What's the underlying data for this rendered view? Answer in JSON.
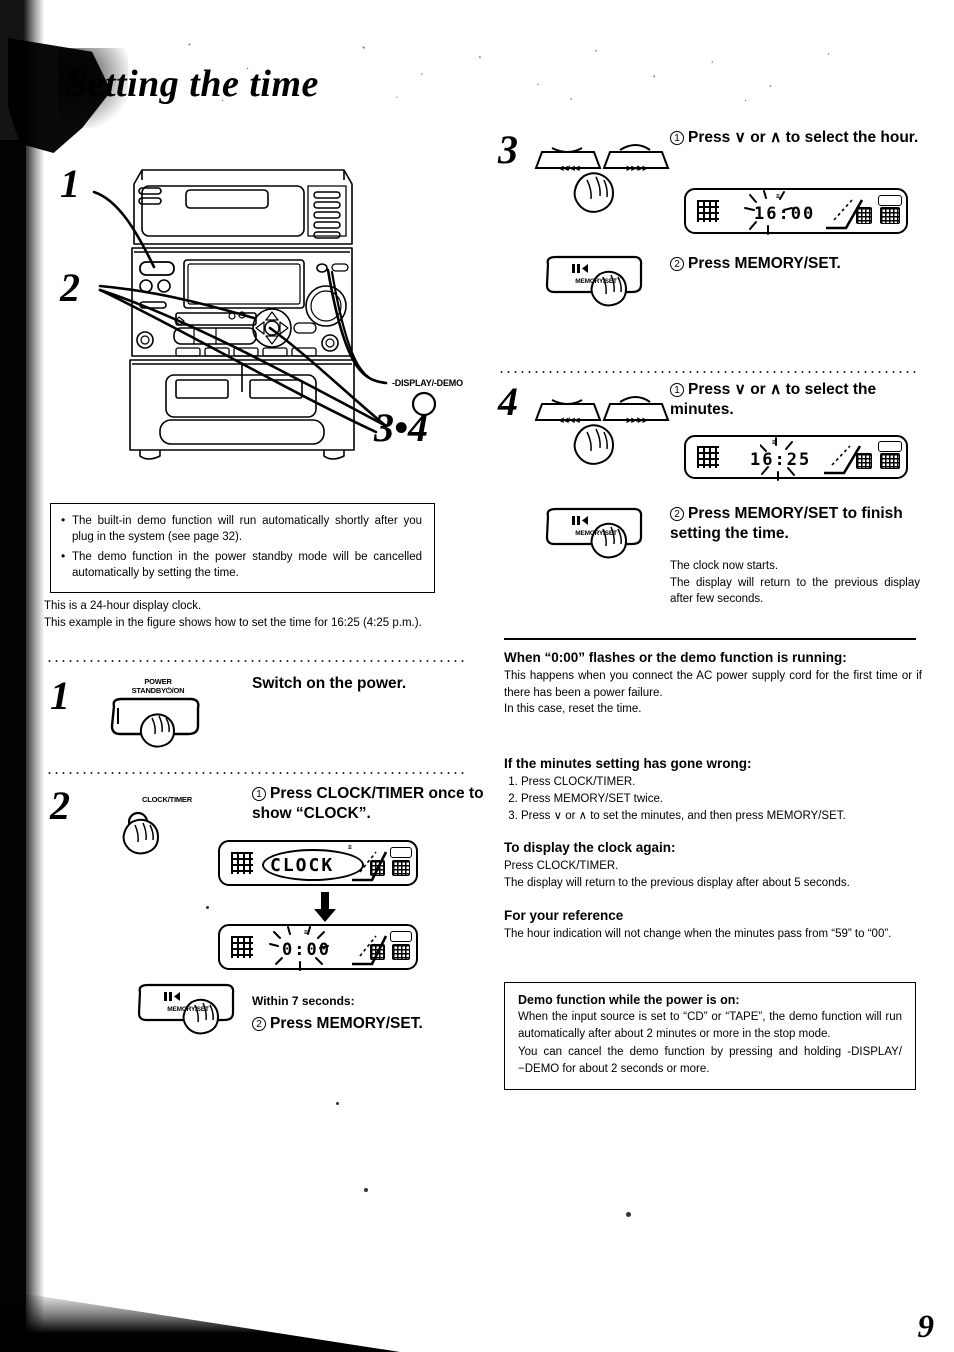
{
  "page": {
    "title": "Setting the time",
    "number": "9"
  },
  "diagram": {
    "callouts": {
      "one": "1",
      "two": "2",
      "three_four": "3•4"
    },
    "display_demo_label": "-DISPLAY/-DEMO"
  },
  "notebox": {
    "bullets": [
      "The built-in demo function will run automatically shortly after you plug in the system (see page 32).",
      "The demo function in the power standby mode will be cancelled automatically by setting the time."
    ]
  },
  "intro": {
    "line1": "This is a 24-hour display clock.",
    "line2": "This example in the figure shows how to set the time for 16:25 (4:25 p.m.)."
  },
  "steps": [
    {
      "number": "1",
      "button_label_line1": "POWER",
      "button_label_line2": "STANDBY⏻/ON",
      "instruction": "Switch on the power."
    },
    {
      "number": "2",
      "button_label": "CLOCK/TIMER",
      "sub1_marker": "1",
      "sub1_text": "Press CLOCK/TIMER once to show “CLOCK”.",
      "display_1": "CLOCK",
      "display_2": "0:00",
      "timing_note": "Within 7 seconds:",
      "sub2_marker": "2",
      "sub2_text": "Press MEMORY/SET.",
      "memory_set_label": "MEMORY/SET"
    },
    {
      "number": "3",
      "skip_back_label": "◀◀/◀◀",
      "skip_fwd_label": "▶▶/▶▶",
      "sub1_marker": "1",
      "sub1_text": "Press ∨ or ∧ to select the hour.",
      "display": "16:00",
      "sub2_marker": "2",
      "sub2_text": "Press MEMORY/SET.",
      "memory_set_label": "MEMORY/SET"
    },
    {
      "number": "4",
      "skip_back_label": "◀◀/◀◀",
      "skip_fwd_label": "▶▶/▶▶",
      "sub1_marker": "1",
      "sub1_text": "Press ∨ or ∧ to select the minutes.",
      "display": "16:25",
      "sub2_marker": "2",
      "sub2_text": "Press MEMORY/SET to finish setting the time.",
      "memory_set_label": "MEMORY/SET",
      "after_note": "The clock now starts.\nThe display will return to the previous display after few seconds."
    }
  ],
  "sections": [
    {
      "heading": "When “0:00” flashes or the demo function is running:",
      "body": "This happens when you connect the AC power supply cord for the first time or if there has been a power failure.\nIn this case, reset the time."
    },
    {
      "heading": "If the minutes setting has gone wrong:",
      "list": [
        "Press CLOCK/TIMER.",
        "Press MEMORY/SET twice.",
        "Press ∨ or ∧ to set the minutes, and then press MEMORY/SET."
      ]
    },
    {
      "heading": "To display the clock again:",
      "body": "Press CLOCK/TIMER.\nThe display will return to the previous display after about 5 seconds."
    },
    {
      "heading": "For your reference",
      "body": "The hour indication will not change when the minutes pass from “59” to “00”."
    }
  ],
  "demobox": {
    "heading": "Demo function while the power is on:",
    "paragraph1": "When the input source is set to “CD” or “TAPE”, the demo function will run automatically after about 2 minutes or more in the stop mode.",
    "paragraph2": "You can cancel the demo function by pressing and holding -DISPLAY/−DEMO for about 2 seconds or more."
  },
  "colors": {
    "ink": "#000000",
    "paper": "#ffffff"
  }
}
